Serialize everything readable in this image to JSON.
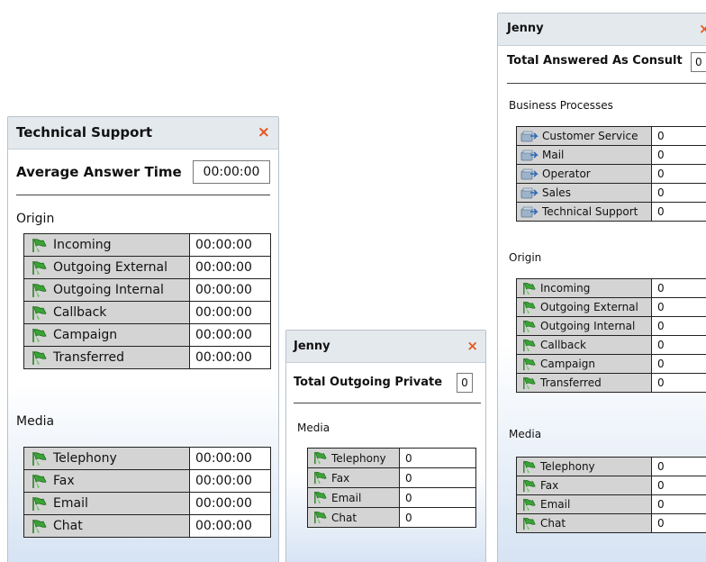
{
  "colors": {
    "close": "#e8561c",
    "flag": "#3aa336",
    "name_cell": "#d4d4d4"
  },
  "icons": {
    "row": "green-flag-icon",
    "process": "business-process-icon",
    "close": "close-icon"
  },
  "panels": [
    {
      "title": "Technical Support",
      "close_label": "×",
      "stat_label": "Average Answer Time",
      "stat_value": "00:00:00",
      "sections": [
        {
          "label": "Origin",
          "rows": [
            {
              "name": "Incoming",
              "value": "00:00:00"
            },
            {
              "name": "Outgoing External",
              "value": "00:00:00"
            },
            {
              "name": "Outgoing Internal",
              "value": "00:00:00"
            },
            {
              "name": "Callback",
              "value": "00:00:00"
            },
            {
              "name": "Campaign",
              "value": "00:00:00"
            },
            {
              "name": "Transferred",
              "value": "00:00:00"
            }
          ]
        },
        {
          "label": "Media",
          "rows": [
            {
              "name": "Telephony",
              "value": "00:00:00"
            },
            {
              "name": "Fax",
              "value": "00:00:00"
            },
            {
              "name": "Email",
              "value": "00:00:00"
            },
            {
              "name": "Chat",
              "value": "00:00:00"
            }
          ]
        }
      ]
    },
    {
      "title": "Jenny",
      "close_label": "×",
      "stat_label": "Total Outgoing Private",
      "stat_value": "0",
      "sections": [
        {
          "label": "Media",
          "rows": [
            {
              "name": "Telephony",
              "value": "0"
            },
            {
              "name": "Fax",
              "value": "0"
            },
            {
              "name": "Email",
              "value": "0"
            },
            {
              "name": "Chat",
              "value": "0"
            }
          ]
        }
      ]
    },
    {
      "title": "Jenny",
      "close_label": "×",
      "stat_label": "Total Answered As Consult",
      "stat_value": "0",
      "sections": [
        {
          "label": "Business Processes",
          "rows": [
            {
              "name": "Customer Service",
              "value": "0"
            },
            {
              "name": "Mail",
              "value": "0"
            },
            {
              "name": "Operator",
              "value": "0"
            },
            {
              "name": "Sales",
              "value": "0"
            },
            {
              "name": "Technical Support",
              "value": "0"
            }
          ]
        },
        {
          "label": "Origin",
          "rows": [
            {
              "name": "Incoming",
              "value": "0"
            },
            {
              "name": "Outgoing External",
              "value": "0"
            },
            {
              "name": "Outgoing Internal",
              "value": "0"
            },
            {
              "name": "Callback",
              "value": "0"
            },
            {
              "name": "Campaign",
              "value": "0"
            },
            {
              "name": "Transferred",
              "value": "0"
            }
          ]
        },
        {
          "label": "Media",
          "rows": [
            {
              "name": "Telephony",
              "value": "0"
            },
            {
              "name": "Fax",
              "value": "0"
            },
            {
              "name": "Email",
              "value": "0"
            },
            {
              "name": "Chat",
              "value": "0"
            }
          ]
        }
      ]
    }
  ]
}
